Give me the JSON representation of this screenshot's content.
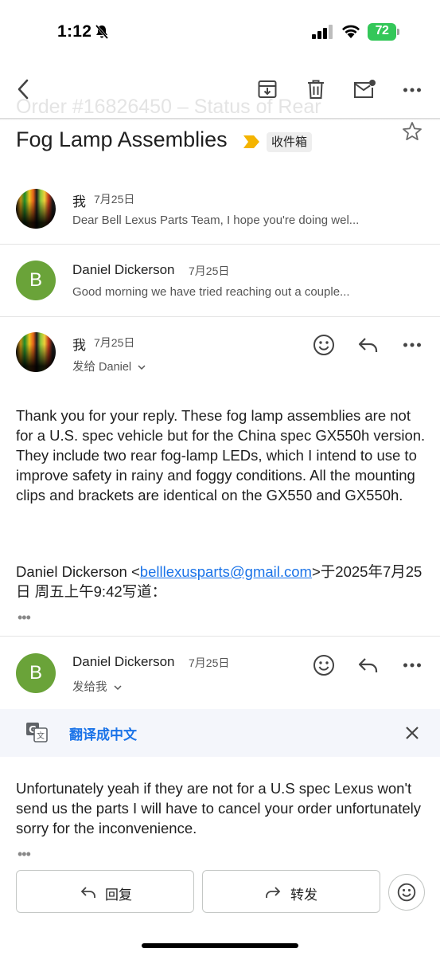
{
  "status_bar": {
    "time": "1:12",
    "battery": "72"
  },
  "toolbar": {
    "icons": [
      "back-arrow-icon",
      "archive-icon",
      "trash-icon",
      "mark-unread-icon",
      "more-icon"
    ]
  },
  "subject": {
    "ghost_text": "Order #16826450 – Status of Rear",
    "title": "Fog Lamp Assemblies",
    "label": "收件箱",
    "important_color": "#f4b400"
  },
  "messages": [
    {
      "sender": "我",
      "date": "7月25日",
      "snippet": "Dear Bell Lexus Parts Team, I hope you're doing wel..."
    },
    {
      "sender": "Daniel Dickerson",
      "avatar_letter": "B",
      "date": "7月25日",
      "snippet": "Good morning we have tried reaching out a couple..."
    },
    {
      "sender": "我",
      "date": "7月25日",
      "recipient": "发给 Daniel",
      "body": "Thank you for your reply. These fog lamp assemblies are not for a U.S. spec vehicle but for the China spec GX550h version. They include two rear fog-lamp LEDs, which I intend to use to improve safety in rainy and foggy conditions. All the mounting clips and brackets are identical on the GX550 and GX550h.",
      "quote_prefix": "Daniel Dickerson <",
      "quote_email": "belllexusparts@gmail.com",
      "quote_suffix": ">于2025年7月25日 周五上午9:42写道：",
      "dots": "•••"
    },
    {
      "sender": "Daniel Dickerson",
      "avatar_letter": "B",
      "date": "7月25日",
      "recipient": "发给我",
      "body": "Unfortunately yeah if they are not for a U.S spec Lexus won't send us the parts I will have to cancel your order unfortunately sorry for the inconvenience.",
      "dots": "•••"
    }
  ],
  "translate": {
    "label": "翻译成中文"
  },
  "actions": {
    "reply": "回复",
    "forward": "转发"
  },
  "colors": {
    "accent": "#1a73e8",
    "avatar_green": "#6aa339"
  }
}
